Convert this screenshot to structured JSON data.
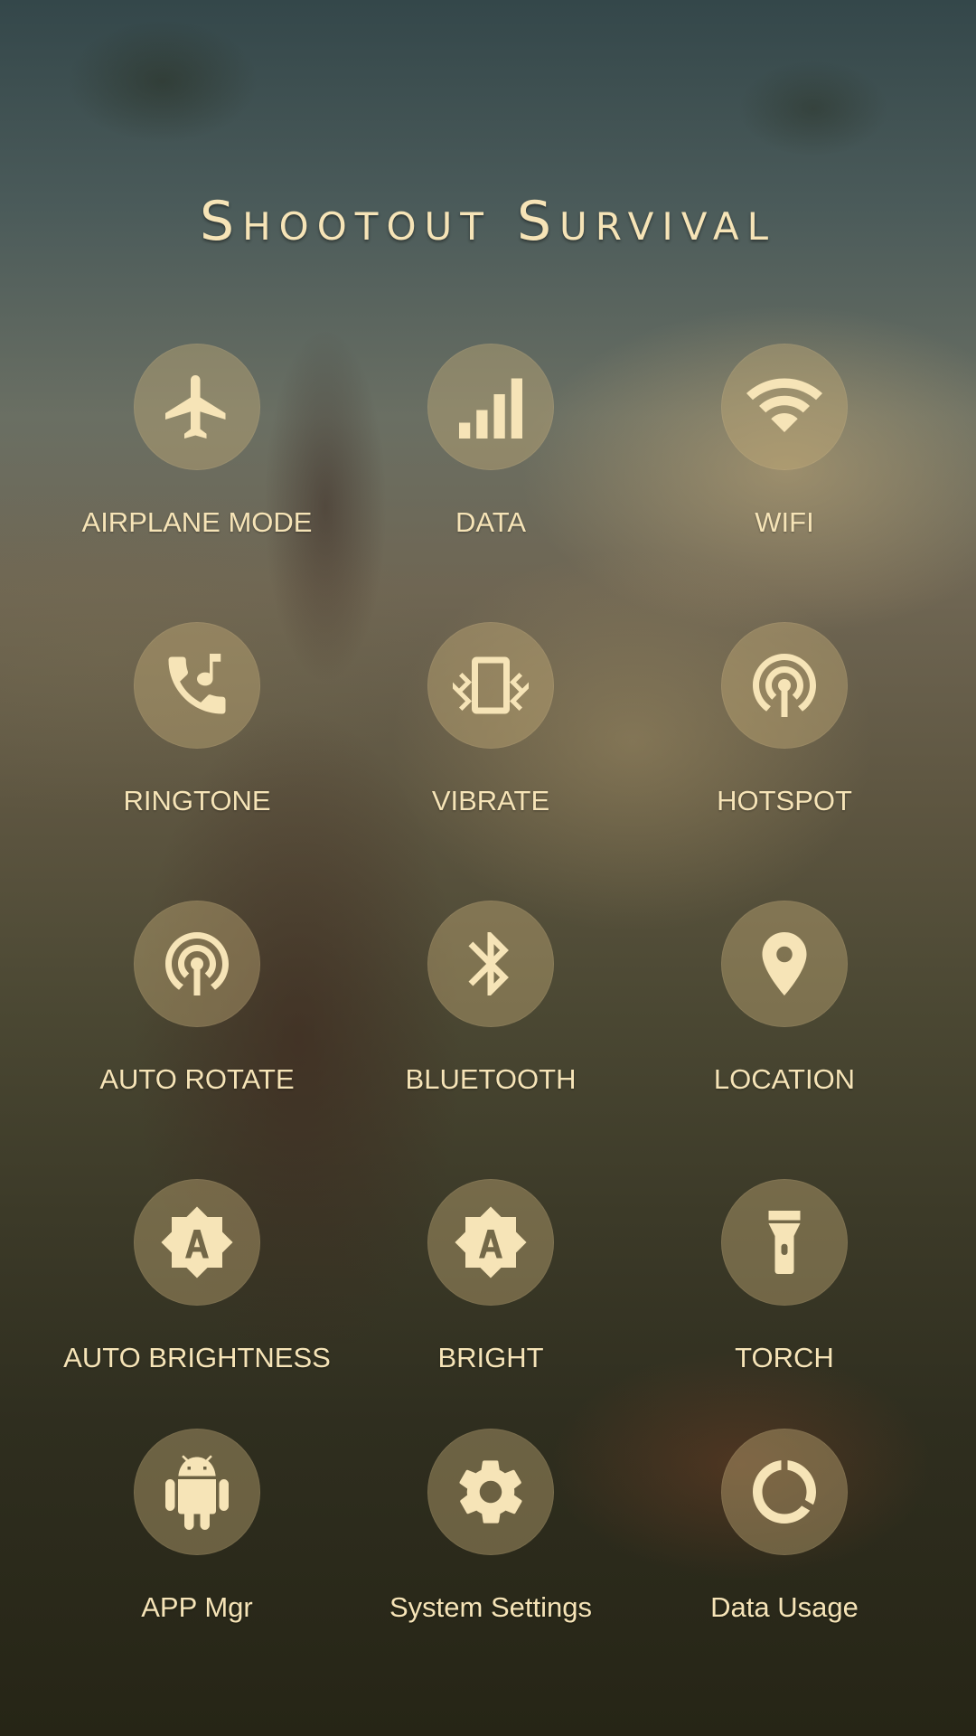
{
  "title": "Shootout Survival",
  "colors": {
    "text": "#f6e4b7",
    "tile_background": "rgba(196,172,118,0.42)"
  },
  "tiles": [
    {
      "label": "AIRPLANE MODE",
      "icon": "airplane-icon"
    },
    {
      "label": "DATA",
      "icon": "signal-bars-icon"
    },
    {
      "label": "WIFI",
      "icon": "wifi-icon"
    },
    {
      "label": "RINGTONE",
      "icon": "phone-ring-icon"
    },
    {
      "label": "VIBRATE",
      "icon": "vibrate-icon"
    },
    {
      "label": "HOTSPOT",
      "icon": "hotspot-icon"
    },
    {
      "label": "AUTO ROTATE",
      "icon": "hotspot-icon"
    },
    {
      "label": "BLUETOOTH",
      "icon": "bluetooth-icon"
    },
    {
      "label": "LOCATION",
      "icon": "location-pin-icon"
    },
    {
      "label": "AUTO BRIGHTNESS",
      "icon": "auto-brightness-icon"
    },
    {
      "label": "BRIGHT",
      "icon": "auto-brightness-icon"
    },
    {
      "label": "TORCH",
      "icon": "flashlight-icon"
    },
    {
      "label": "APP Mgr",
      "icon": "android-icon"
    },
    {
      "label": "System Settings",
      "icon": "gear-icon"
    },
    {
      "label": "Data Usage",
      "icon": "data-usage-ring-icon"
    }
  ]
}
